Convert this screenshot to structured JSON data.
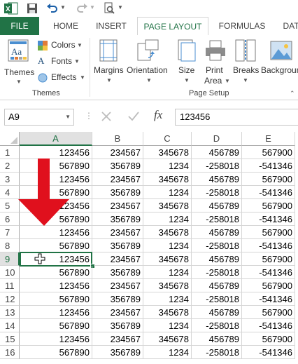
{
  "qat": {
    "icons": [
      "excel-logo-icon",
      "save-icon",
      "undo-icon",
      "redo-icon",
      "print-preview-icon"
    ]
  },
  "tabs": [
    "FILE",
    "HOME",
    "INSERT",
    "PAGE LAYOUT",
    "FORMULAS",
    "DAT"
  ],
  "active_tab": "PAGE LAYOUT",
  "ribbon": {
    "themes_group": {
      "themes_label": "Themes",
      "colors_label": "Colors",
      "fonts_label": "Fonts",
      "effects_label": "Effects",
      "group_label": "Themes"
    },
    "page_setup": {
      "margins": "Margins",
      "orientation": "Orientation",
      "size": "Size",
      "print_area_1": "Print",
      "print_area_2": "Area",
      "breaks": "Breaks",
      "background": "Background",
      "group_label": "Page Setup"
    }
  },
  "formula_bar": {
    "name_box": "A9",
    "formula": "123456",
    "fx": "fx"
  },
  "columns": [
    "A",
    "B",
    "C",
    "D",
    "E"
  ],
  "selected_column": "A",
  "selected_row": "9",
  "rows": [
    {
      "n": "1",
      "v": [
        "123456",
        "234567",
        "345678",
        "456789",
        "567900"
      ]
    },
    {
      "n": "2",
      "v": [
        "567890",
        "356789",
        "1234",
        "-258018",
        "-541346"
      ]
    },
    {
      "n": "3",
      "v": [
        "123456",
        "234567",
        "345678",
        "456789",
        "567900"
      ]
    },
    {
      "n": "4",
      "v": [
        "567890",
        "356789",
        "1234",
        "-258018",
        "-541346"
      ]
    },
    {
      "n": "5",
      "v": [
        "123456",
        "234567",
        "345678",
        "456789",
        "567900"
      ]
    },
    {
      "n": "6",
      "v": [
        "567890",
        "356789",
        "1234",
        "-258018",
        "-541346"
      ]
    },
    {
      "n": "7",
      "v": [
        "123456",
        "234567",
        "345678",
        "456789",
        "567900"
      ]
    },
    {
      "n": "8",
      "v": [
        "567890",
        "356789",
        "1234",
        "-258018",
        "-541346"
      ]
    },
    {
      "n": "9",
      "v": [
        "123456",
        "234567",
        "345678",
        "456789",
        "567900"
      ]
    },
    {
      "n": "10",
      "v": [
        "567890",
        "356789",
        "1234",
        "-258018",
        "-541346"
      ]
    },
    {
      "n": "11",
      "v": [
        "123456",
        "234567",
        "345678",
        "456789",
        "567900"
      ]
    },
    {
      "n": "12",
      "v": [
        "567890",
        "356789",
        "1234",
        "-258018",
        "-541346"
      ]
    },
    {
      "n": "13",
      "v": [
        "123456",
        "234567",
        "345678",
        "456789",
        "567900"
      ]
    },
    {
      "n": "14",
      "v": [
        "567890",
        "356789",
        "1234",
        "-258018",
        "-541346"
      ]
    },
    {
      "n": "15",
      "v": [
        "123456",
        "234567",
        "345678",
        "456789",
        "567900"
      ]
    },
    {
      "n": "16",
      "v": [
        "567890",
        "356789",
        "1234",
        "-258018",
        "-541346"
      ]
    }
  ],
  "colors": {
    "accent": "#217346",
    "arrow": "#e0101d"
  }
}
